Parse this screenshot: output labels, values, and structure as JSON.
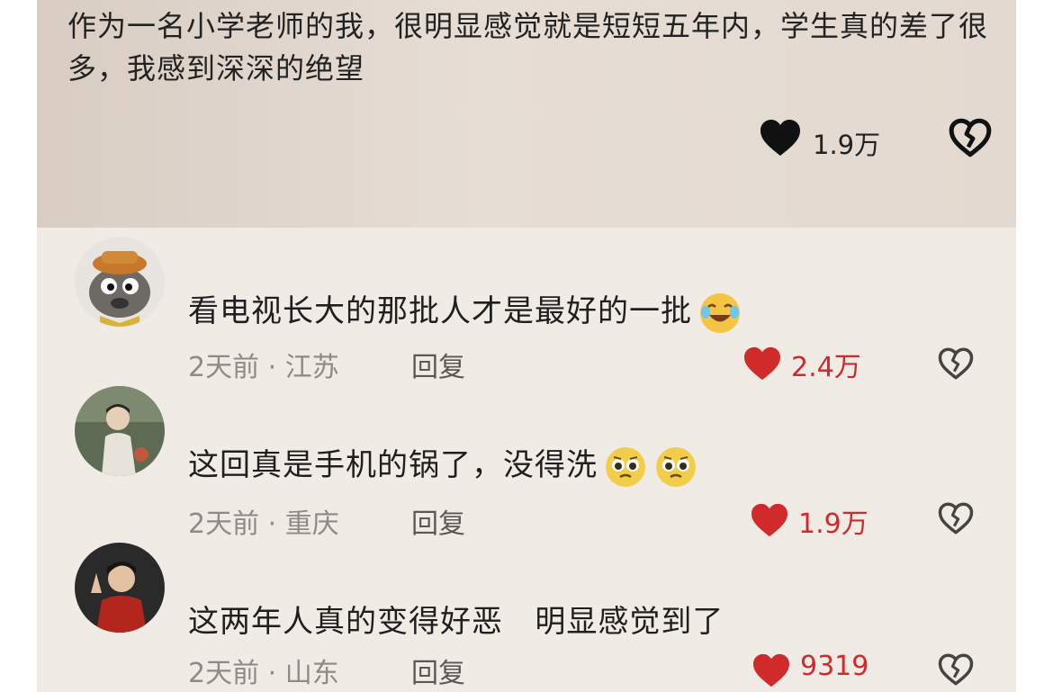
{
  "post": {
    "text": "作为一名小学老师的我，很明显感觉就是短短五年内，学生真的差了很多，我感到深深的绝望",
    "like_count": "1.9万"
  },
  "comments": [
    {
      "text": "看电视长大的那批人才是最好的一批",
      "time": "2天前",
      "location": "江苏",
      "reply_label": "回复",
      "like_count": "2.4万",
      "emoji": [
        "laughing-tears-emoji"
      ]
    },
    {
      "text": "这回真是手机的锅了，没得洗",
      "time": "2天前",
      "location": "重庆",
      "reply_label": "回复",
      "like_count": "1.9万",
      "emoji": [
        "pleading-face-emoji",
        "pleading-face-emoji"
      ]
    },
    {
      "text": "这两年人真的变得好恶   明显感觉到了",
      "time": "2天前",
      "location": "山东",
      "reply_label": "回复",
      "like_count": "9319",
      "emoji": []
    }
  ],
  "meta_separator": " · ",
  "colors": {
    "like_red": "#d12a2a",
    "meta_gray": "#8f8a86",
    "background": "#f1ebe6"
  }
}
